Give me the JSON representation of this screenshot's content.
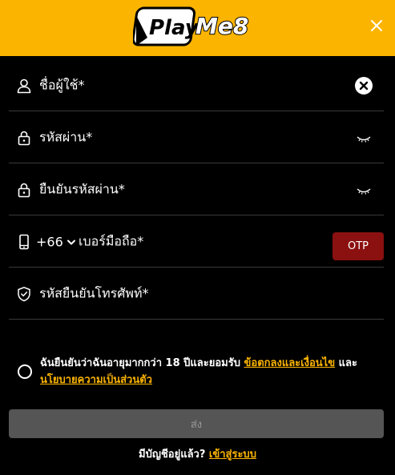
{
  "header": {
    "logo_alt": "PlayMe8",
    "logo_left": "Play",
    "logo_right": "Me8",
    "close_icon": "close-icon",
    "bg_color": "#fbb400"
  },
  "form": {
    "username": {
      "label": "ชื่อผู้ใช้*",
      "icon": "user-icon",
      "action_icon": "clear-icon"
    },
    "password": {
      "label": "รหัสผ่าน*",
      "icon": "lock-icon",
      "action_icon": "eye-closed-icon"
    },
    "confirm_password": {
      "label": "ยืนยันรหัสผ่าน*",
      "icon": "lock-icon",
      "action_icon": "eye-closed-icon"
    },
    "phone": {
      "country_code": "+66",
      "label": "เบอร์มือถือ*",
      "icon": "mobile-icon",
      "otp_label": "OTP"
    },
    "otp_code": {
      "label": "รหัสยืนยันโทรศัพท์*",
      "icon": "shield-check-icon"
    }
  },
  "consent": {
    "text_before": "ฉันยืนยันว่าฉันอายุมากกว่า 18 ปีและยอมรับ ",
    "terms_link": "ข้อตกลงและเงื่อนไข",
    "text_middle": " และ ",
    "privacy_link": "นโยบายความเป็นส่วนตัว"
  },
  "submit_label": "ส่ง",
  "footer": {
    "question": "มีบัญชีอยู่แล้ว? ",
    "login_link": "เข้าสู่ระบบ"
  },
  "colors": {
    "accent": "#fbb400",
    "otp_button": "#8b1010",
    "submit_disabled": "#555555"
  }
}
